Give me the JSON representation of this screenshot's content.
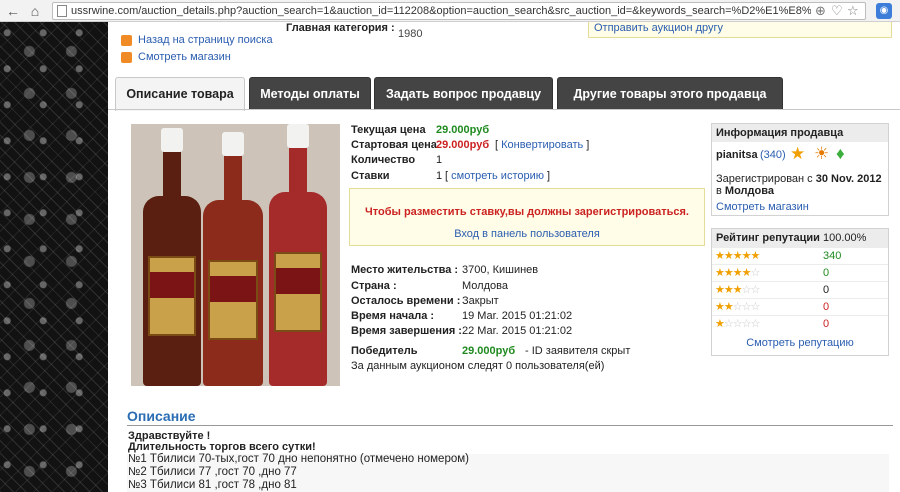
{
  "browser": {
    "url": "ussrwine.com/auction_details.php?auction_search=1&auction_id=112208&option=auction_search&src_auction_id=&keywords_search=%D2%E1%E8%EB%E8"
  },
  "top": {
    "links": [
      {
        "label": "Назад на страницу поиска"
      },
      {
        "label": "Смотреть магазин"
      }
    ],
    "category_label": "Главная категория :",
    "category_value": "1980",
    "notify_link": "Отправить аукцион другу"
  },
  "tabs": [
    {
      "label": "Описание товара",
      "active": true
    },
    {
      "label": "Методы оплаты",
      "active": false
    },
    {
      "label": "Задать вопрос продавцу",
      "active": false
    },
    {
      "label": "Другие товары этого продавца",
      "active": false
    }
  ],
  "details": {
    "current_price_label": "Текущая цена",
    "current_price": "29.000руб",
    "start_price_label": "Стартовая цена",
    "start_price": "29.000руб",
    "convert_link": "Конвертировать",
    "quantity_label": "Количество",
    "quantity": "1",
    "bids_label": "Ставки",
    "bids": "1",
    "history_link": "смотреть историю",
    "notice": "Чтобы разместить ставку,вы должны зарегистрироваться.",
    "login_link": "Вход в панель пользователя",
    "location_label": "Место жительства :",
    "location": "3700, Кишинев",
    "country_label": "Страна :",
    "country": "Молдова",
    "time_left_label": "Осталось времени :",
    "time_left": "Закрыт",
    "start_time_label": "Время начала :",
    "start_time": "19 Mar. 2015 01:21:02",
    "end_time_label": "Время завершения :",
    "end_time": "22 Mar. 2015 01:21:02",
    "winner_label": "Победитель",
    "winner_price": "29.000руб",
    "winner_note": "- ID заявителя скрыт",
    "watchers": "За данным аукционом следят 0 пользователя(ей)"
  },
  "seller": {
    "header": "Информация продавца",
    "name": "pianitsa",
    "rating_count": "(340)",
    "registered_prefix": "Зарегистрирован с",
    "registered_date": "30 Nov. 2012",
    "registered_in": "в",
    "registered_country": "Молдова",
    "shop_link": "Смотреть магазин"
  },
  "reputation": {
    "header": "Рейтинг репутации",
    "percent": "100.00%",
    "rows": [
      {
        "stars": 5,
        "count": "340",
        "color": "#1f8a1f"
      },
      {
        "stars": 4,
        "count": "0",
        "color": "#1f8a1f"
      },
      {
        "stars": 3,
        "count": "0",
        "color": "#222222"
      },
      {
        "stars": 2,
        "count": "0",
        "color": "#cc2222"
      },
      {
        "stars": 1,
        "count": "0",
        "color": "#cc2222"
      }
    ],
    "more_link": "Смотреть репутацию"
  },
  "description": {
    "title": "Описание",
    "greeting": "Здравствуйте !",
    "duration": "Длительность торгов всего сутки!",
    "lines": [
      "№1 Тбилиси 70-тых,гост 70 дно непонятно (отмечено номером)",
      "№2 Тбилиси 77 ,гост 70 ,дно 77",
      "№3 Тбилиси 81 ,гост 78 ,дно 81"
    ]
  }
}
